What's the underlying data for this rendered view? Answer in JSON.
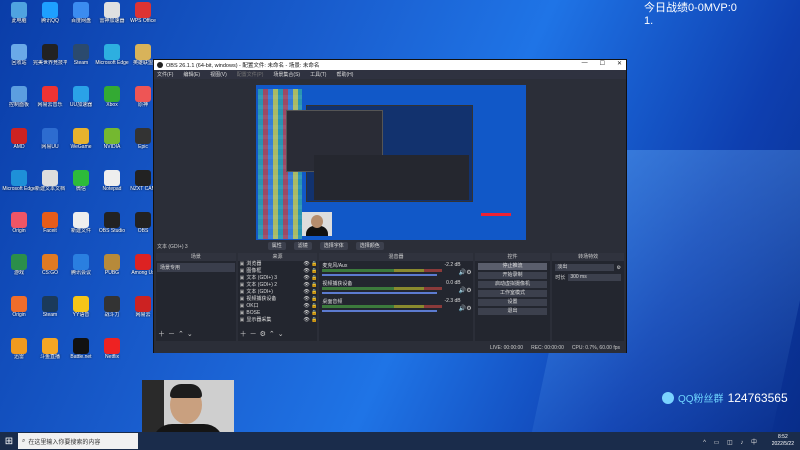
{
  "overlay": {
    "stats": "今日战绩0-0MVP:0",
    "stats_line2": "1.",
    "qq_prefix": "QQ粉丝群",
    "qq_number": "124763565"
  },
  "desktop": {
    "icons": [
      {
        "label": "此电脑",
        "color": "#4fa3e0"
      },
      {
        "label": "腾讯QQ",
        "color": "#1ea0ff"
      },
      {
        "label": "百度网盘",
        "color": "#3b8cf0"
      },
      {
        "label": "雷神加速器",
        "color": "#e0e0e0"
      },
      {
        "label": "WPS Office",
        "color": "#d33"
      },
      {
        "label": "回收站",
        "color": "#6aa9e8"
      },
      {
        "label": "完美世界竞技平台",
        "color": "#222"
      },
      {
        "label": "Steam",
        "color": "#2b4a6e"
      },
      {
        "label": "Microsoft Edge",
        "color": "#2dafe0"
      },
      {
        "label": "英雄联盟",
        "color": "#d8b35a"
      },
      {
        "label": "控制面板",
        "color": "#5c9ee0"
      },
      {
        "label": "网易云音乐",
        "color": "#e33"
      },
      {
        "label": "UU加速器",
        "color": "#2aa2e8"
      },
      {
        "label": "Xbox",
        "color": "#3a3"
      },
      {
        "label": "原神",
        "color": "#e55"
      },
      {
        "label": "AMD",
        "color": "#c22"
      },
      {
        "label": "网易UU",
        "color": "#2d6cd0"
      },
      {
        "label": "WeGame",
        "color": "#e6b22e"
      },
      {
        "label": "NVIDIA",
        "color": "#74b830"
      },
      {
        "label": "Epic",
        "color": "#333"
      },
      {
        "label": "Microsoft Edge",
        "color": "#1e90d8"
      },
      {
        "label": "新建文本文档",
        "color": "#ddd"
      },
      {
        "label": "微信",
        "color": "#2dbb3a"
      },
      {
        "label": "Notepad",
        "color": "#eee"
      },
      {
        "label": "NZXT CAM",
        "color": "#222"
      },
      {
        "label": "Origin",
        "color": "#e56"
      },
      {
        "label": "Faceit",
        "color": "#e65c1a"
      },
      {
        "label": "新建文件",
        "color": "#eee"
      },
      {
        "label": "OBS Studio",
        "color": "#222"
      },
      {
        "label": "OBS",
        "color": "#222"
      },
      {
        "label": "游戏",
        "color": "#2b8f4a"
      },
      {
        "label": "CS:GO",
        "color": "#e07a22"
      },
      {
        "label": "腾讯会议",
        "color": "#2a7fe0"
      },
      {
        "label": "PUBG",
        "color": "#b78a3a"
      },
      {
        "label": "Among Us",
        "color": "#d22"
      },
      {
        "label": "Origin",
        "color": "#f06d2b"
      },
      {
        "label": "Steam",
        "color": "#1b3a5a"
      },
      {
        "label": "YY语音",
        "color": "#f5c518"
      },
      {
        "label": "战斗力",
        "color": "#333"
      },
      {
        "label": "网易云",
        "color": "#c22"
      },
      {
        "label": "迅雷",
        "color": "#f09a1e"
      },
      {
        "label": "斗鱼直播",
        "color": "#f5a623"
      },
      {
        "label": "Battle.net",
        "color": "#111"
      },
      {
        "label": "Netflix",
        "color": "#e22"
      }
    ]
  },
  "obs": {
    "title": "OBS 26.1.1 (64-bit, windows) - 配置文件: 未命名 - 场景: 未命名",
    "window_controls": {
      "minimize": "—",
      "maximize": "☐",
      "close": "✕"
    },
    "menu": [
      "文件(F)",
      "编辑(E)",
      "视图(V)",
      "配置文件(P)",
      "场景集合(S)",
      "工具(T)",
      "帮助(H)"
    ],
    "source_bar": {
      "label": "文本 (GDI+) 3",
      "props": "属性",
      "filters": "滤镜",
      "select_font": "选择字体",
      "select_color": "选择颜色"
    },
    "scenes": {
      "header": "场景",
      "items": [
        "场景专用"
      ]
    },
    "sources": {
      "header": "来源",
      "items": [
        "浏览器",
        "图像框",
        "文本 (GDI+) 3",
        "文本 (GDI+) 2",
        "文本 (GDI+)",
        "视频捕获设备",
        "OK口",
        "BOSE",
        "显示器采集"
      ]
    },
    "mixer": {
      "header": "混音器",
      "items": [
        {
          "name": "麦克风/Aux",
          "db": "-2.2 dB"
        },
        {
          "name": "视频捕获设备",
          "db": "0.0 dB"
        },
        {
          "name": "桌面音频",
          "db": "-2.3 dB"
        }
      ]
    },
    "controls": {
      "header": "控件",
      "buttons": [
        "停止推流",
        "开始录制",
        "启动虚拟摄像机",
        "工作室模式",
        "设置",
        "退出"
      ]
    },
    "transitions": {
      "header": "转场特效",
      "type": "淡出",
      "duration_label": "时长",
      "duration": "300 ms"
    },
    "status": {
      "live": "LIVE: 00:00:00",
      "rec": "REC: 00:00:00",
      "cpu": "CPU: 0.7%, 60.00 fps"
    }
  },
  "taskbar": {
    "search_placeholder": "在这里输入你要搜索的内容",
    "time": "8:52",
    "date": "2022/5/22"
  }
}
